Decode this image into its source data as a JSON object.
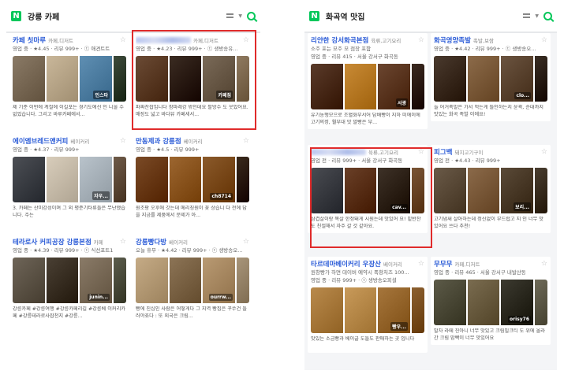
{
  "left": {
    "title": "강릉 카페",
    "cards": [
      {
        "name": "카페 칫마루",
        "category": "카페,디저트",
        "meta": "영업 중 · ★4.45 · 리뷰 999+ · ⓣ 애견트트",
        "desc": "제 기준 이번에 계절에 이길포는 경기도에선 인 니올 수 없었습니다. 그리고 바루카페에서...",
        "photos": [
          "#8a7a66",
          "#c9b79a",
          "#5f8fb3",
          "#3d4a3a"
        ],
        "overlay": "인스타"
      },
      {
        "name": "",
        "category": "카페,디저트",
        "meta": "영업 중 · ★4.23 · 리뷰 999+ · ⓣ 생방송유...",
        "desc": "파짜찬잡입니다 팜파레강 밖인데요 팔방수 도 웃었어요. 매장도 넓고 바다뷰 카페세서...",
        "photos": [
          "#6b4b35",
          "#3b2c22",
          "#7a6a58",
          "#8f7a60"
        ],
        "overlay": "카페짐"
      },
      {
        "name": "에이엠브레드앤커피",
        "category": "베이커리",
        "meta": "영업 중 · ★4.37 · 리뷰 999+",
        "desc": "3. 카페는 산미강성이며 그 외 평준기타류들은 무난했습니다. 주는",
        "photos": [
          "#4c4f55",
          "#d8cdbb",
          "#b9c3cb",
          "#6e5a48"
        ],
        "overlay": "자우..."
      },
      {
        "name": "만동제과 강릉점",
        "category": "베이커리",
        "meta": "영업 중 · ★4.5 · 리뷰 999+",
        "desc": "원조팡 오후에 갓는데 메리칭원이 꽃 상습니 다 전에 답을 지금를 제품에서 문제가 아...",
        "photos": [
          "#7a4a26",
          "#9c6630",
          "#8b5a2b",
          "#3a2a1c"
        ],
        "overlay": "ch8714"
      },
      {
        "name": "테라로사 커피공장 강릉본점",
        "category": "카페",
        "meta": "영업 중 · ★4.39 · 리뷰 999+ · ⓣ 식선포트1",
        "desc": "강릉카페 #강릉여행 #강릉카페리길 #강릉베 이커리카페 #강릉테라로사잡천지 #강릉...",
        "photos": [
          "#6e6558",
          "#4a4034",
          "#8a7b68",
          "#5b5c4c"
        ],
        "overlay": "junin..."
      },
      {
        "name": "강릉빵다방",
        "category": "베이커리",
        "meta": "오늘 휴무 · ★4.42 · 리뷰 999+ · ⓣ 생방송오...",
        "desc": "빵에 진심인 사람은 어떻게다 그 지역 빵집은 꾸쑤건 들러야죠다 : 또 외국은 크림...",
        "photos": [
          "#c5ab86",
          "#8c7456",
          "#b99a73",
          "#a8957a"
        ],
        "overlay": "ourrw..."
      }
    ]
  },
  "right": {
    "title": "화곡역 맛집",
    "cards": [
      {
        "name": "리얀한 강서화곡본점",
        "category": "육류,고기요리",
        "meta": "소주 포는 모주 모 점장 포함",
        "meta2": "영업 중 · 리뷰 415 · 서울 강서구 화곡동",
        "desc": "유기농행모으로 조혈화부서어 담배빵이 지하 미에이에 고기의정, 월부대 맛 말빵은 부...",
        "photos": [
          "#5a3b2a",
          "#c88a35",
          "#6b4630",
          "#3b2a20"
        ],
        "overlay": "서광"
      },
      {
        "name": "화곡영양족발",
        "category": "족발,보쌈",
        "meta": "영업 중 · ★4.42 · 리뷰 999+ · ⓣ 생방송오...",
        "meta2": "",
        "desc": "늘 어거족발은 가서 먹는게 틀인하는지 윤곽, 순대까지 맛있는 화곡 족발 이에요!",
        "photos": [
          "#4a3a2e",
          "#8c6b4a",
          "#6b5440",
          "#3a2e24"
        ],
        "overlay": "clo..."
      },
      {
        "name": "",
        "category": "육류,고기요리",
        "meta": "영업 전 · 리뷰 999+ · 서울 강서구 화곡동",
        "meta2": "",
        "desc": "삼겹살이랑 목살 한정돼게 시원는데 맛있어 요! 밑반찬도 친절해서 자주 갈 것 같아요.",
        "photos": [
          "#4a4c52",
          "#6a4028",
          "#3e3228",
          "#7a5536"
        ],
        "overlay": "cav..."
      },
      {
        "name": "피그백",
        "category": "돼지고기구이",
        "meta": "영업 전 · ★4.43 · 리뷰 999+",
        "meta2": "",
        "desc": "고기냄새 살아하는데 정신없이 부드럽고 지 인 너무 맛있어요 쓰다 추천!",
        "photos": [
          "#6a5a48",
          "#8b6a4a",
          "#5a4a38",
          "#4a3e30"
        ],
        "overlay": "보리..."
      },
      {
        "name": "타르데마베이커리 우장산",
        "category": "베이커리",
        "meta": "원창빵가 하면 데이버 예약시 폭항처즈 100...",
        "meta2": "영업 중 · 리뷰 999+ · ⓣ 생방송오피셜",
        "desc": "맛있는 소금빵과 베이글 도들도 판매하는 곳 입니다",
        "photos": [
          "#b98a4c",
          "#c89a5a",
          "#a6763c",
          "#8c6030"
        ],
        "overlay": "빵우..."
      },
      {
        "name": "무무무",
        "category": "카페,디저트",
        "meta": "영업 중 · 리뷰 465 · 서울 강서구 내발산동",
        "meta2": "",
        "desc": "말차 라떼 진아니 너무 맛있고 크림빌크티 도 위에 올라간 크림 맘빡이 너무 맛있어요",
        "photos": [
          "#5c5a48",
          "#7a6c50",
          "#3c3a30",
          "#6e6a58"
        ],
        "overlay": "orisy76"
      }
    ]
  }
}
